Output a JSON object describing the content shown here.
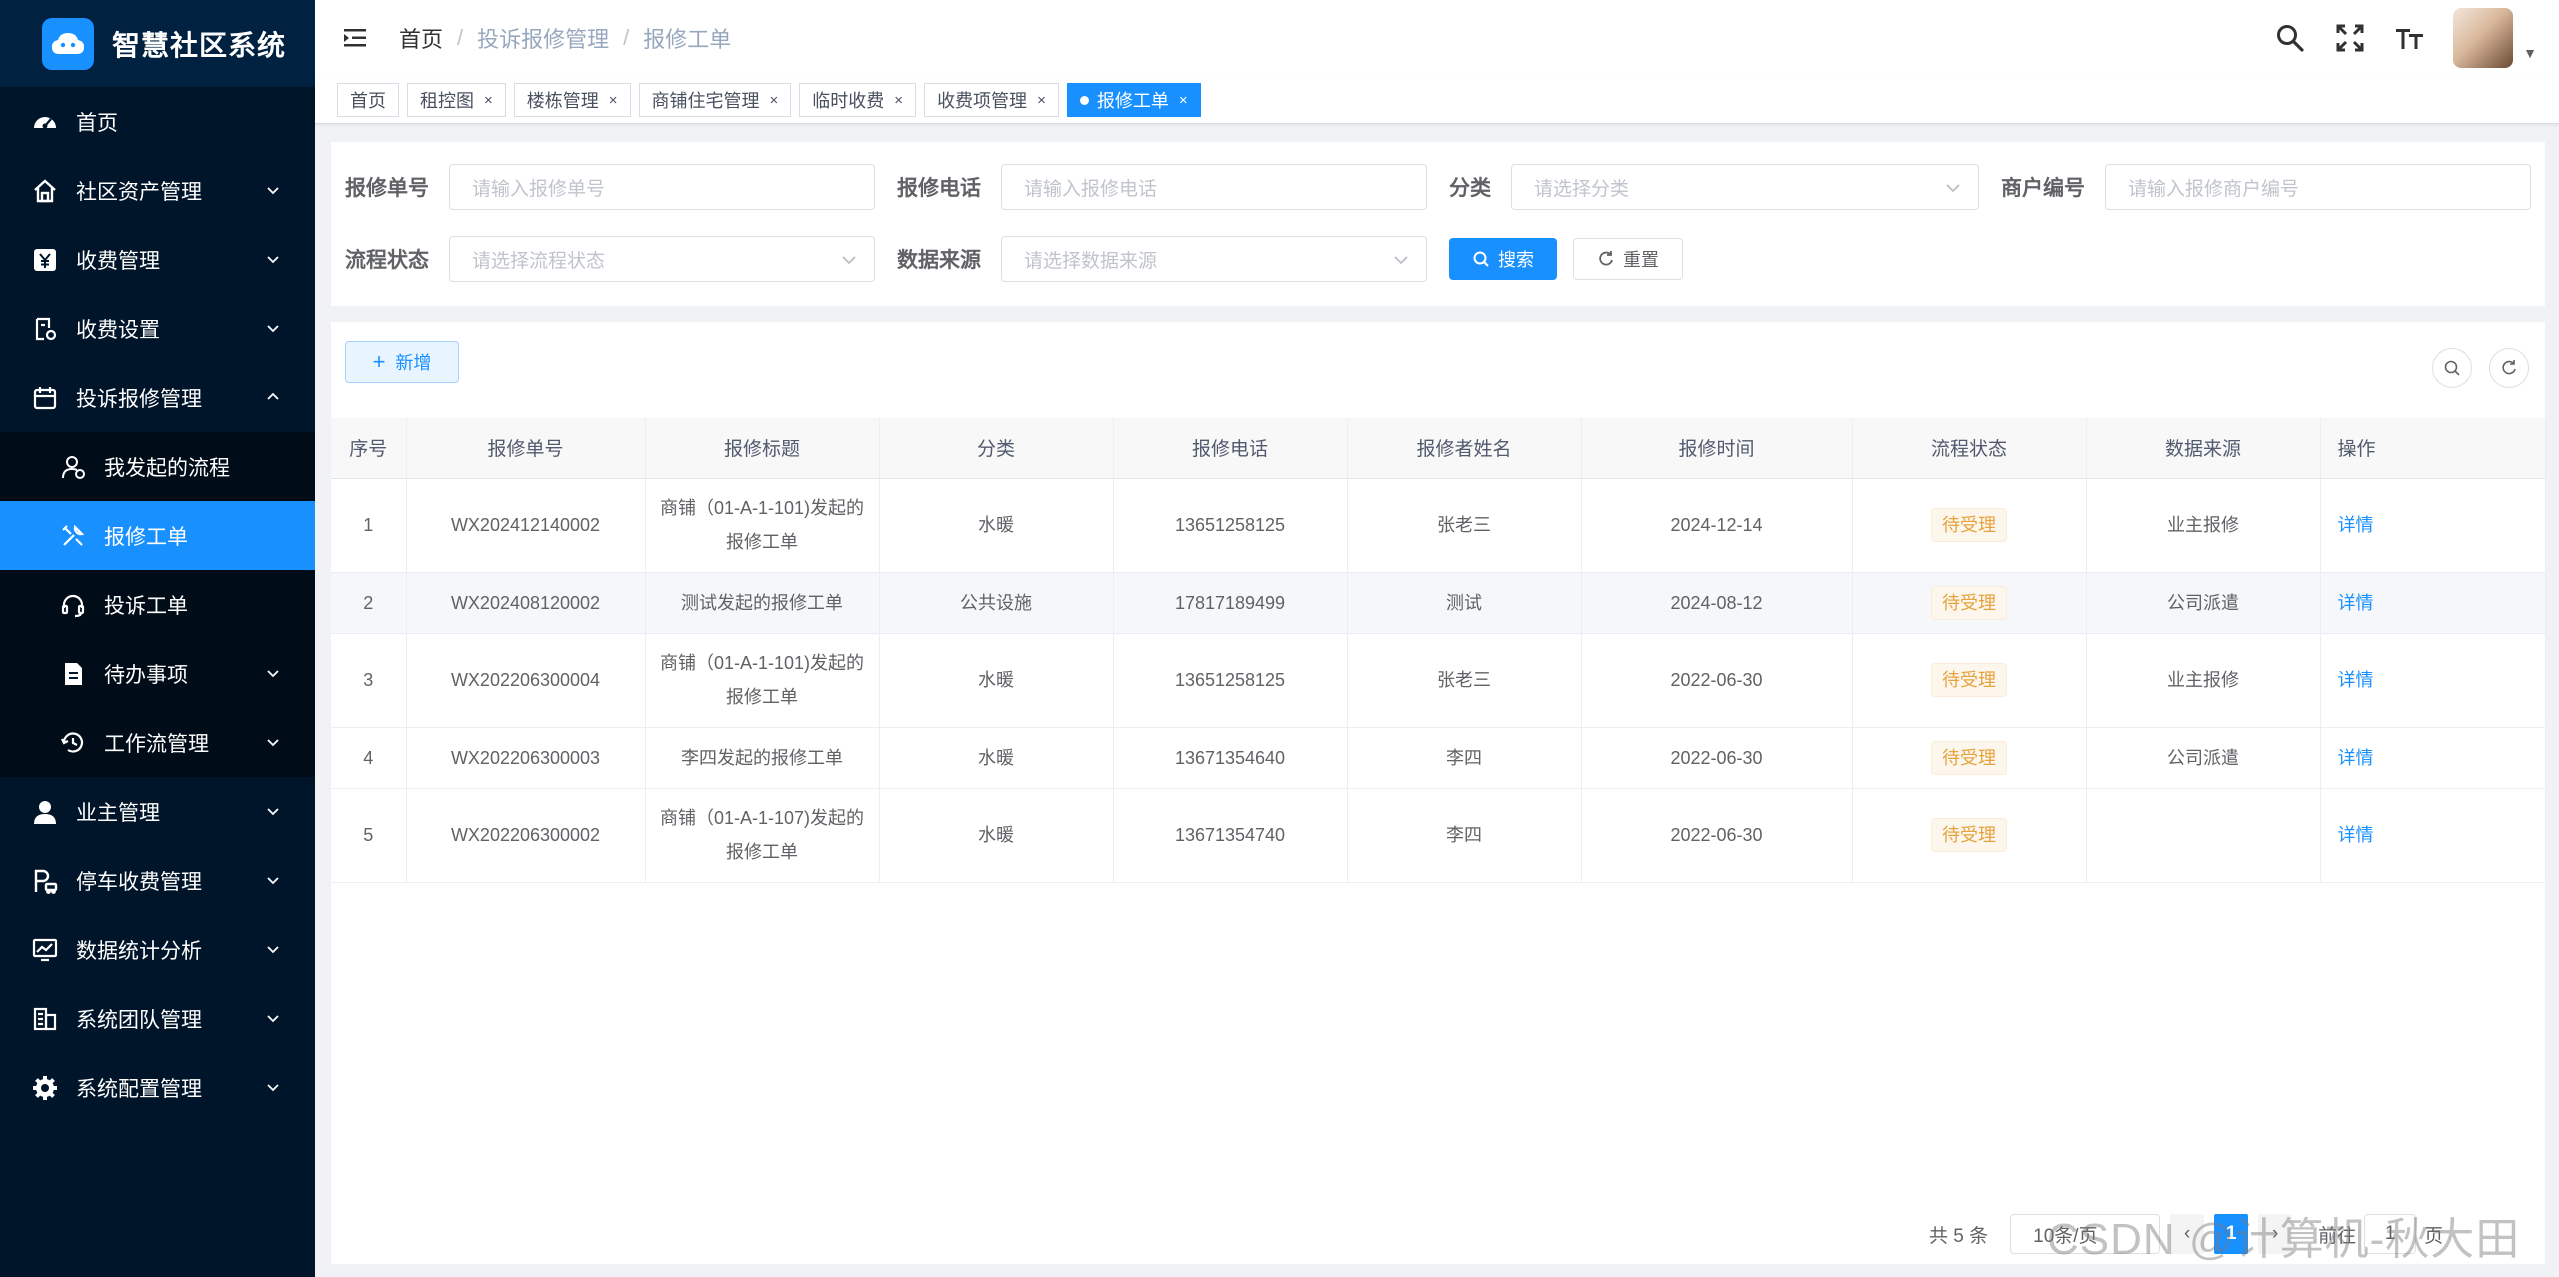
{
  "app": {
    "title": "智慧社区系统"
  },
  "sidebar": {
    "items": [
      {
        "label": "首页",
        "icon": "dashboard-icon"
      },
      {
        "label": "社区资产管理",
        "icon": "home-icon",
        "expandable": true
      },
      {
        "label": "收费管理",
        "icon": "yen-icon",
        "expandable": true
      },
      {
        "label": "收费设置",
        "icon": "bill-settings-icon",
        "expandable": true
      },
      {
        "label": "投诉报修管理",
        "icon": "calendar-icon",
        "expandable": true,
        "expanded": true
      }
    ],
    "submenu": [
      {
        "label": "我发起的流程",
        "icon": "user-flow-icon"
      },
      {
        "label": "报修工单",
        "icon": "tools-icon",
        "active": true
      },
      {
        "label": "投诉工单",
        "icon": "headset-icon"
      },
      {
        "label": "待办事项",
        "icon": "todo-icon",
        "expandable": true
      },
      {
        "label": "工作流管理",
        "icon": "workflow-icon",
        "expandable": true
      }
    ],
    "items_after": [
      {
        "label": "业主管理",
        "icon": "user-icon",
        "expandable": true
      },
      {
        "label": "停车收费管理",
        "icon": "parking-icon",
        "expandable": true
      },
      {
        "label": "数据统计分析",
        "icon": "chart-icon",
        "expandable": true
      },
      {
        "label": "系统团队管理",
        "icon": "team-icon",
        "expandable": true
      },
      {
        "label": "系统配置管理",
        "icon": "gear-icon",
        "expandable": true
      }
    ]
  },
  "header": {
    "breadcrumb": [
      "首页",
      "投诉报修管理",
      "报修工单"
    ]
  },
  "tags": [
    {
      "label": "首页",
      "closable": false
    },
    {
      "label": "租控图",
      "closable": true
    },
    {
      "label": "楼栋管理",
      "closable": true
    },
    {
      "label": "商铺住宅管理",
      "closable": true
    },
    {
      "label": "临时收费",
      "closable": true
    },
    {
      "label": "收费项管理",
      "closable": true
    },
    {
      "label": "报修工单",
      "closable": true,
      "active": true
    }
  ],
  "search": {
    "order_no": {
      "label": "报修单号",
      "placeholder": "请输入报修单号"
    },
    "phone": {
      "label": "报修电话",
      "placeholder": "请输入报修电话"
    },
    "category": {
      "label": "分类",
      "placeholder": "请选择分类"
    },
    "merchant": {
      "label": "商户编号",
      "placeholder": "请输入报修商户编号"
    },
    "flow_status": {
      "label": "流程状态",
      "placeholder": "请选择流程状态"
    },
    "source": {
      "label": "数据来源",
      "placeholder": "请选择数据来源"
    },
    "search_btn": "搜索",
    "reset_btn": "重置"
  },
  "toolbar": {
    "add_label": "新增"
  },
  "table": {
    "columns": [
      "序号",
      "报修单号",
      "报修标题",
      "分类",
      "报修电话",
      "报修者姓名",
      "报修时间",
      "流程状态",
      "数据来源",
      "操作"
    ],
    "rows": [
      {
        "idx": "1",
        "no": "WX202412140002",
        "title": "商铺（01-A-1-101)发起的报修工单",
        "category": "水暖",
        "phone": "13651258125",
        "name": "张老三",
        "time": "2024-12-14",
        "status": "待受理",
        "source": "业主报修",
        "action": "详情"
      },
      {
        "idx": "2",
        "no": "WX202408120002",
        "title": "测试发起的报修工单",
        "category": "公共设施",
        "phone": "17817189499",
        "name": "测试",
        "time": "2024-08-12",
        "status": "待受理",
        "source": "公司派遣",
        "action": "详情"
      },
      {
        "idx": "3",
        "no": "WX202206300004",
        "title": "商铺（01-A-1-101)发起的报修工单",
        "category": "水暖",
        "phone": "13651258125",
        "name": "张老三",
        "time": "2022-06-30",
        "status": "待受理",
        "source": "业主报修",
        "action": "详情"
      },
      {
        "idx": "4",
        "no": "WX202206300003",
        "title": "李四发起的报修工单",
        "category": "水暖",
        "phone": "13671354640",
        "name": "李四",
        "time": "2022-06-30",
        "status": "待受理",
        "source": "公司派遣",
        "action": "详情"
      },
      {
        "idx": "5",
        "no": "WX202206300002",
        "title": "商铺（01-A-1-107)发起的报修工单",
        "category": "水暖",
        "phone": "13671354740",
        "name": "李四",
        "time": "2022-06-30",
        "status": "待受理",
        "source": "",
        "action": "详情"
      }
    ]
  },
  "pagination": {
    "total": "共 5 条",
    "page_size": "10条/页",
    "current_page": "1",
    "goto_prefix": "前往",
    "goto_value": "1",
    "goto_suffix": "页"
  },
  "watermark": "CSDN @计算机-秋大田",
  "colors": {
    "primary": "#1890ff",
    "sidebar_bg": "#001529",
    "warning": "#e6a23c"
  }
}
